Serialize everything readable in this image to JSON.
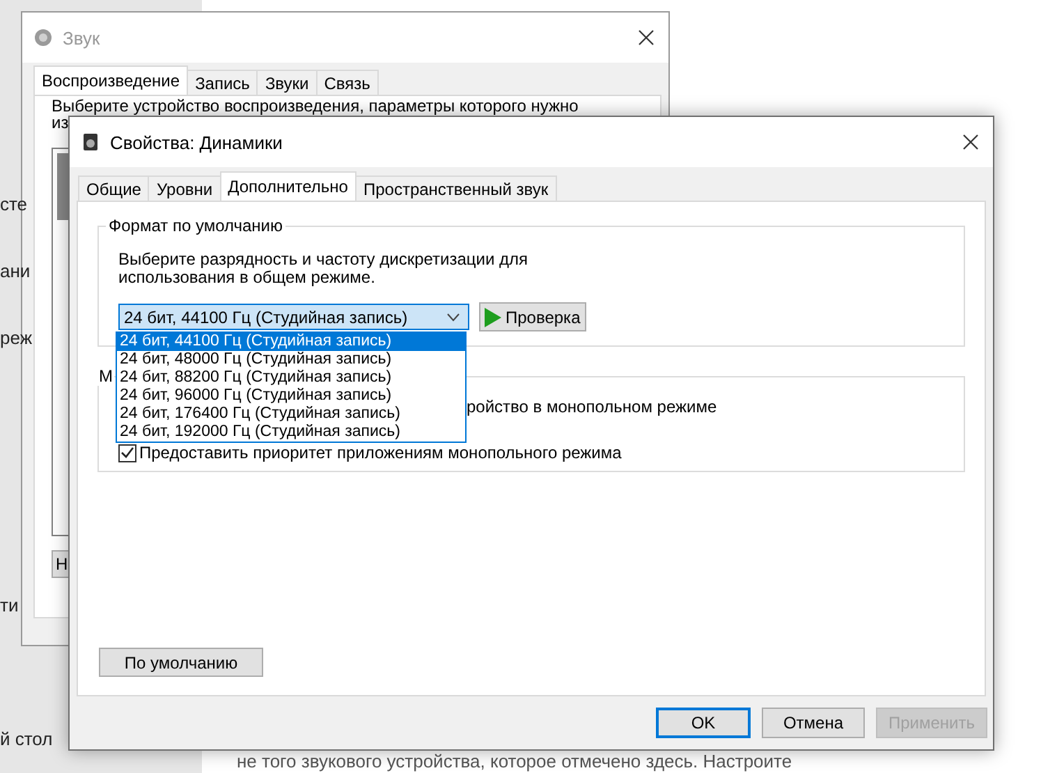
{
  "background_page": {
    "side_fragments": [
      {
        "text": "сте"
      },
      {
        "text": "ани"
      },
      {
        "text": "реж"
      },
      {
        "text": "ти"
      },
      {
        "text": "й стол"
      }
    ],
    "text_line": "не того звукового устройства, которое отмечено здесь. Настроите"
  },
  "sound_window": {
    "title": "Звук",
    "tabs": [
      {
        "label": "Воспроизведение",
        "selected": true
      },
      {
        "label": "Запись",
        "selected": false
      },
      {
        "label": "Звуки",
        "selected": false
      },
      {
        "label": "Связь",
        "selected": false
      }
    ],
    "description": [
      "Выберите устройство воспроизведения, параметры которого нужно",
      "из"
    ],
    "button_fragment": "Н"
  },
  "properties_dialog": {
    "title": "Свойства: Динамики",
    "tabs": [
      {
        "label": "Общие",
        "selected": false
      },
      {
        "label": "Уровни",
        "selected": false
      },
      {
        "label": "Дополнительно",
        "selected": true
      },
      {
        "label": "Пространственный звук",
        "selected": false
      }
    ],
    "format_group": {
      "title": "Формат по умолчанию",
      "description": [
        "Выберите разрядность и частоту дискретизации для",
        "использования в общем режиме."
      ],
      "combo": {
        "value": "24 бит, 44100 Гц (Студийная запись)",
        "expanded": true
      },
      "options": [
        {
          "label": "24 бит, 44100 Гц (Студийная запись)",
          "selected": true
        },
        {
          "label": "24 бит, 48000 Гц (Студийная запись)",
          "selected": false
        },
        {
          "label": "24 бит, 88200 Гц (Студийная запись)",
          "selected": false
        },
        {
          "label": "24 бит, 96000 Гц (Студийная запись)",
          "selected": false
        },
        {
          "label": "24 бит, 176400 Гц (Студийная запись)",
          "selected": false
        },
        {
          "label": "24 бит, 192000 Гц (Студийная запись)",
          "selected": false
        }
      ],
      "test_button": "Проверка"
    },
    "exclusive_group": {
      "title": "М",
      "partial_label": "ройство в монопольном режиме",
      "checkbox": {
        "label": "Предоставить приоритет приложениям монопольного режима",
        "checked": true
      }
    },
    "default_button": "По умолчанию",
    "buttons": [
      {
        "label": "OK",
        "kind": "default",
        "disabled": false
      },
      {
        "label": "Отмена",
        "kind": "normal",
        "disabled": false
      },
      {
        "label": "Применить",
        "kind": "normal",
        "disabled": true
      }
    ]
  }
}
